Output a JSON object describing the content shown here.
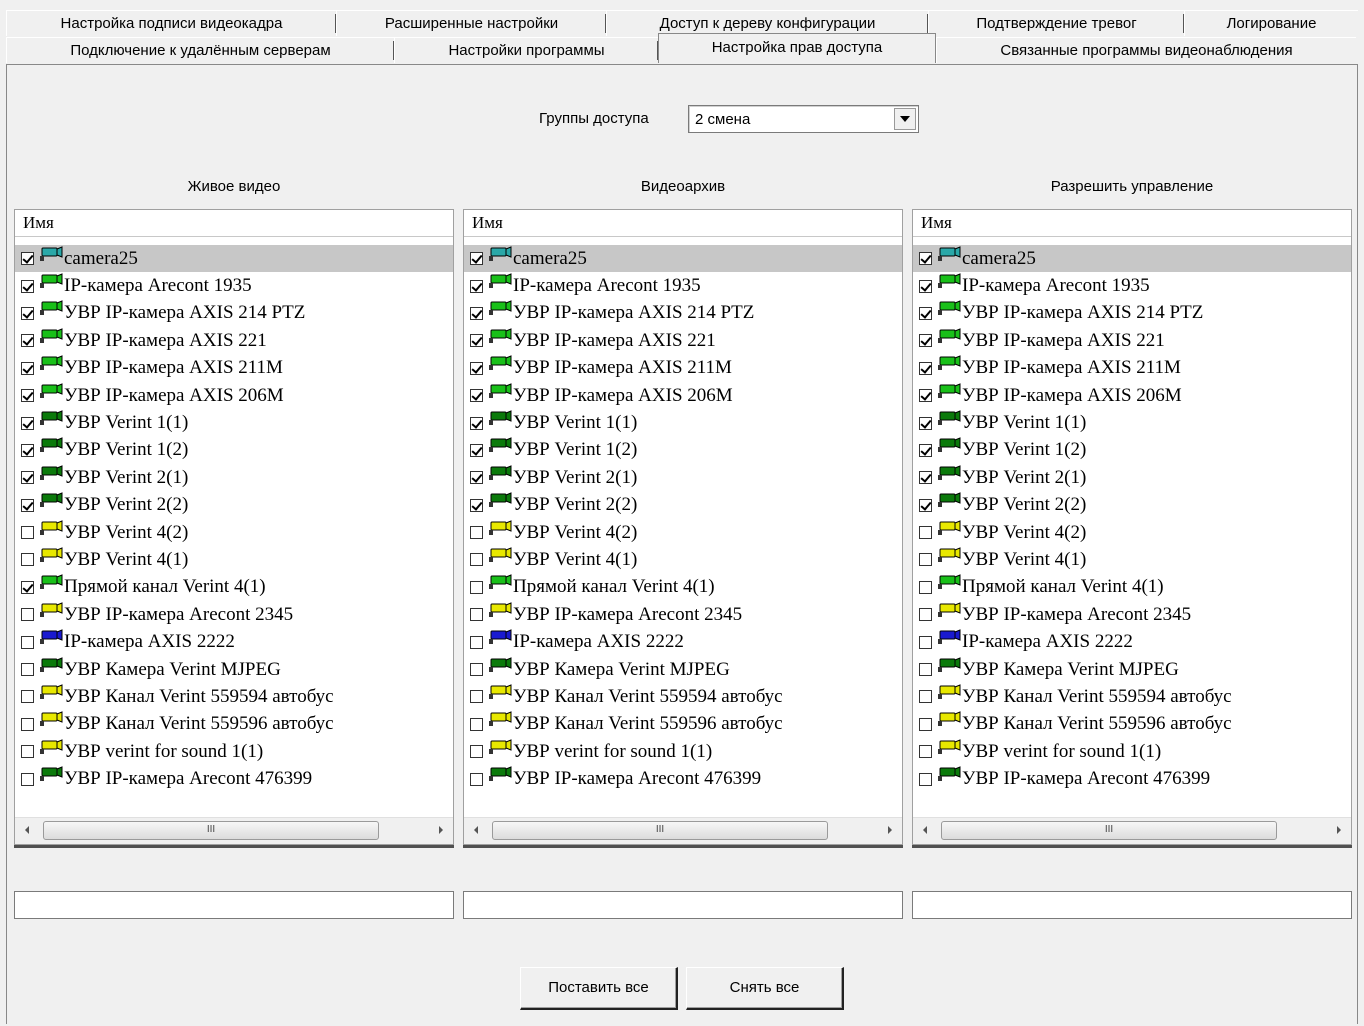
{
  "tabs_row1": [
    "Настройка подписи видеокадра",
    "Расширенные настройки",
    "Доступ к дереву конфигурации",
    "Подтверждение тревог",
    "Логирование"
  ],
  "tabs_row2": [
    "Подключение к удалённым серверам",
    "Настройки программы",
    "Настройка прав доступа",
    "Связанные программы видеонаблюдения"
  ],
  "active_tab": "Настройка прав доступа",
  "access_group": {
    "label": "Группы доступа",
    "value": "2 смена"
  },
  "list_header": "Имя",
  "scroll_thumb_text": "III",
  "icon_colors": {
    "teal": "#2aa8a8",
    "green": "#19c019",
    "darkgreen": "#0b7a0b",
    "yellow": "#e8e800",
    "blue": "#1a1ad0"
  },
  "columns": [
    {
      "title": "Живое видео",
      "checked": [
        1,
        1,
        1,
        1,
        1,
        1,
        1,
        1,
        1,
        1,
        0,
        0,
        1,
        0,
        0,
        0,
        0,
        0,
        0,
        0
      ]
    },
    {
      "title": "Видеоархив",
      "checked": [
        1,
        1,
        1,
        1,
        1,
        1,
        1,
        1,
        1,
        1,
        0,
        0,
        0,
        0,
        0,
        0,
        0,
        0,
        0,
        0
      ]
    },
    {
      "title": "Разрешить управление",
      "checked": [
        1,
        1,
        1,
        1,
        1,
        1,
        1,
        1,
        1,
        1,
        0,
        0,
        0,
        0,
        0,
        0,
        0,
        0,
        0,
        0
      ]
    }
  ],
  "cameras": [
    {
      "name": "camera25",
      "icon": "teal"
    },
    {
      "name": "IP-камера Arecont 1935",
      "icon": "green"
    },
    {
      "name": "УВР IP-камера AXIS 214 PTZ",
      "icon": "green"
    },
    {
      "name": "УВР IP-камера AXIS 221",
      "icon": "green"
    },
    {
      "name": "УВР IP-камера AXIS 211M",
      "icon": "green"
    },
    {
      "name": "УВР IP-камера AXIS 206M",
      "icon": "green"
    },
    {
      "name": "УВР Verint 1(1)",
      "icon": "darkgreen"
    },
    {
      "name": "УВР Verint 1(2)",
      "icon": "darkgreen"
    },
    {
      "name": "УВР Verint 2(1)",
      "icon": "darkgreen"
    },
    {
      "name": "УВР Verint 2(2)",
      "icon": "darkgreen"
    },
    {
      "name": "УВР Verint 4(2)",
      "icon": "yellow"
    },
    {
      "name": "УВР Verint 4(1)",
      "icon": "yellow"
    },
    {
      "name": "Прямой канал Verint 4(1)",
      "icon": "green"
    },
    {
      "name": "УВР IP-камера Arecont 2345",
      "icon": "yellow"
    },
    {
      "name": "IP-камера AXIS 2222",
      "icon": "blue"
    },
    {
      "name": "УВР Камера Verint MJPEG",
      "icon": "darkgreen"
    },
    {
      "name": "УВР Канал Verint 559594 автобус",
      "icon": "yellow"
    },
    {
      "name": "УВР Канал Verint 559596 автобус",
      "icon": "yellow"
    },
    {
      "name": "УВР verint for sound 1(1)",
      "icon": "yellow"
    },
    {
      "name": "УВР IP-камера Arecont 476399",
      "icon": "darkgreen"
    }
  ],
  "selected_row": 0,
  "buttons": {
    "set_all": "Поставить все",
    "clear_all": "Снять все"
  }
}
